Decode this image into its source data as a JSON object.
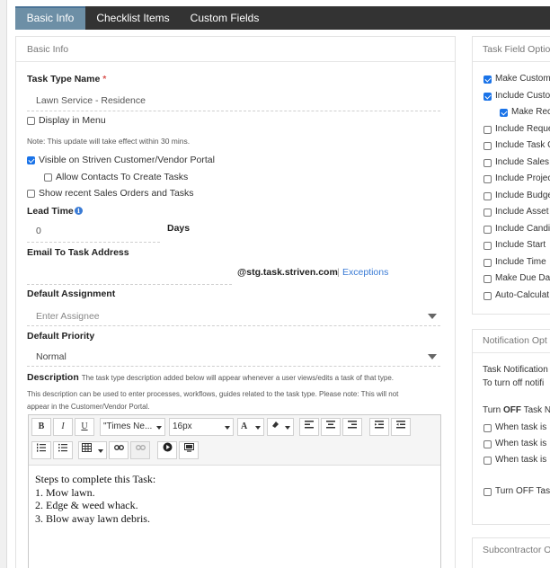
{
  "tabs": [
    {
      "label": "Basic Info",
      "active": true
    },
    {
      "label": "Checklist Items",
      "active": false
    },
    {
      "label": "Custom Fields",
      "active": false
    }
  ],
  "basic": {
    "section_title": "Basic Info",
    "task_type_name_label": "Task Type Name",
    "required_mark": "*",
    "task_type_name_value": "Lawn Service - Residence",
    "display_in_menu": {
      "label": "Display in Menu",
      "checked": false
    },
    "note": "Note: This update will take effect within 30 mins.",
    "visible_portal": {
      "label": "Visible on Striven Customer/Vendor Portal",
      "checked": true
    },
    "allow_contacts": {
      "label": "Allow Contacts To Create Tasks",
      "checked": false
    },
    "show_recent": {
      "label": "Show recent Sales Orders and Tasks",
      "checked": false
    },
    "lead_time_label": "Lead Time",
    "lead_time_value": "0",
    "days_label": "Days",
    "email_label": "Email To Task Address",
    "email_domain": "@stg.task.striven.com",
    "separator": "|",
    "exceptions_link": "Exceptions",
    "default_assignment_label": "Default Assignment",
    "assignee_placeholder": "Enter Assignee",
    "default_priority_label": "Default Priority",
    "priority_value": "Normal",
    "description_label": "Description",
    "description_help_1": "The task type description added below will appear whenever a user views/edits a task of that type.",
    "description_help_2": "This description can be used to enter processes, workflows, guides related to the task type. Please note: This will not",
    "description_help_3": "appear in the Customer/Vendor Portal."
  },
  "editor": {
    "bold": "B",
    "italic": "I",
    "underline": "U",
    "font_family": "\"Times Ne...",
    "font_size": "16px",
    "font_color": "A",
    "content_lines": [
      "Steps to complete this Task:",
      "1. Mow lawn.",
      "2. Edge & weed whack.",
      "3. Blow away lawn debris."
    ]
  },
  "task_field_options": {
    "title": "Task Field Option",
    "items": [
      {
        "label": "Make Custom",
        "checked": true
      },
      {
        "label": "Include Custo",
        "checked": true
      },
      {
        "label": "Make Rec",
        "checked": true,
        "indent": true
      },
      {
        "label": "Include Reque",
        "checked": false
      },
      {
        "label": "Include Task C",
        "checked": false
      },
      {
        "label": "Include Sales",
        "checked": false
      },
      {
        "label": "Include Projec",
        "checked": false
      },
      {
        "label": "Include Budge",
        "checked": false
      },
      {
        "label": "Include Asset",
        "checked": false
      },
      {
        "label": "Include Candi",
        "checked": false
      },
      {
        "label": "Include Start",
        "checked": false
      },
      {
        "label": "Include Time",
        "checked": false
      },
      {
        "label": "Make Due Da",
        "checked": false
      },
      {
        "label": "Auto-Calculat",
        "checked": false
      }
    ]
  },
  "notification_options": {
    "title": "Notification Opt",
    "line1": "Task Notification",
    "line2": "To turn off notifi",
    "turn_off_prefix": "Turn ",
    "turn_off_bold": "OFF",
    "turn_off_suffix": " Task N",
    "items": [
      {
        "label": "When task is",
        "checked": false
      },
      {
        "label": "When task is",
        "checked": false
      },
      {
        "label": "When task is",
        "checked": false
      }
    ],
    "turn_off_task": {
      "label": "Turn OFF Tas",
      "checked": false
    }
  },
  "subcontractor": {
    "title": "Subcontractor O"
  }
}
